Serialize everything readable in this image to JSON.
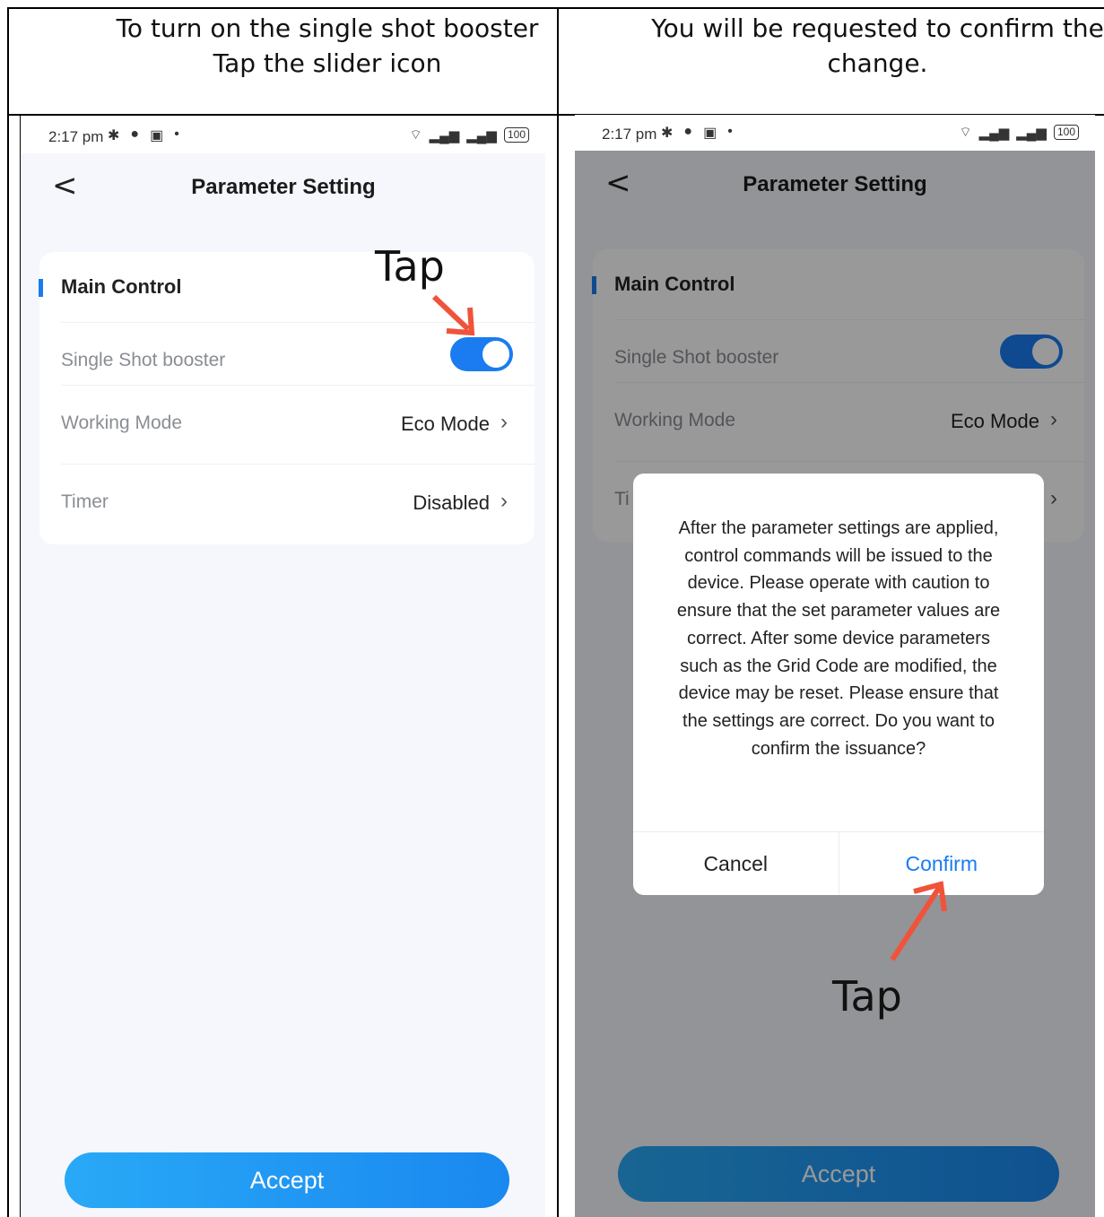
{
  "left": {
    "caption_line1": "To turn on the single shot booster",
    "caption_line2": "Tap the slider icon",
    "status": {
      "time": "2:17 pm",
      "battery": "100"
    },
    "title": "Parameter Setting",
    "back_glyph": "<",
    "section": "Main Control",
    "rows": [
      {
        "label": "Single Shot booster",
        "toggle_on": true
      },
      {
        "label": "Working Mode",
        "value": "Eco Mode"
      },
      {
        "label": "Timer",
        "value": "Disabled"
      }
    ],
    "accept": "Accept",
    "annotation": "Tap"
  },
  "right": {
    "caption_line1": "You will be requested to confirm the",
    "caption_line2": "change.",
    "status": {
      "time": "2:17 pm",
      "battery": "100"
    },
    "title": "Parameter Setting",
    "back_glyph": "<",
    "section": "Main Control",
    "rows": [
      {
        "label": "Single Shot booster",
        "toggle_on": true
      },
      {
        "label": "Working Mode",
        "value": "Eco Mode"
      },
      {
        "label": "Ti",
        "value": ""
      }
    ],
    "dialog": {
      "message": "After the parameter settings are applied, control commands will be issued to the device. Please operate with caution to ensure that the set parameter values are correct. After some device parameters such as the Grid Code are modified, the device may be reset. Please ensure that the settings are correct. Do you want to confirm the issuance?",
      "cancel": "Cancel",
      "confirm": "Confirm"
    },
    "accept": "Accept",
    "annotation": "Tap"
  },
  "colors": {
    "accent": "#1a7cf0",
    "arrow": "#f0533a"
  }
}
